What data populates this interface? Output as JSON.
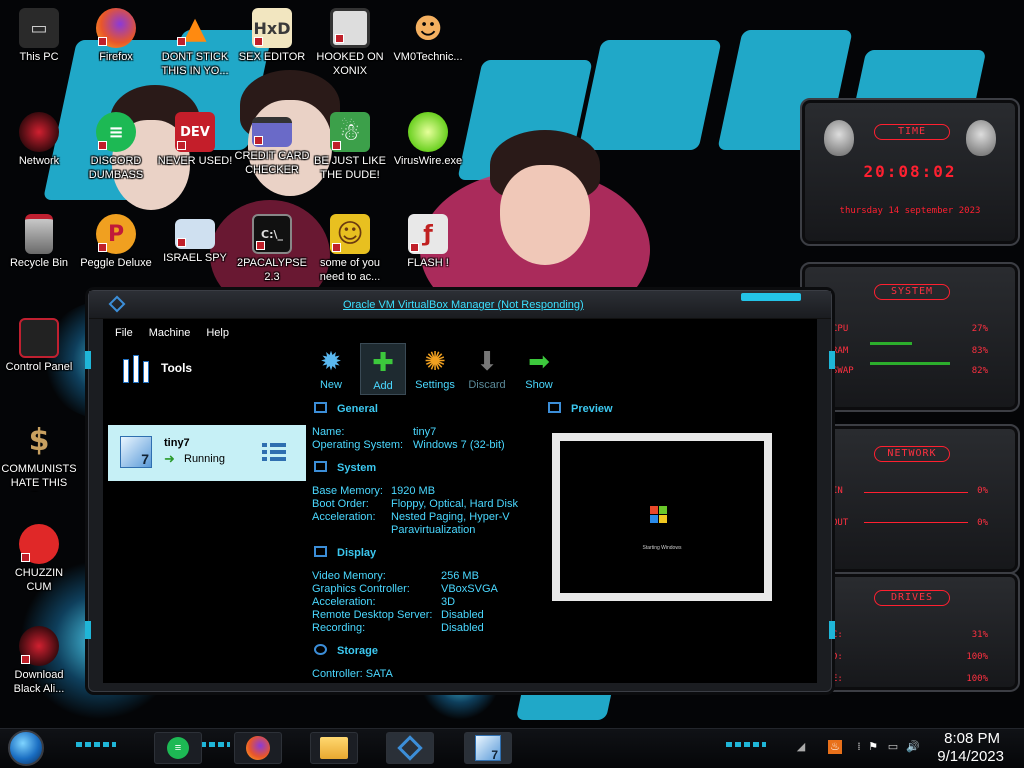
{
  "desktop": {
    "icons": [
      {
        "label": "This PC",
        "icon": "computer-icon"
      },
      {
        "label": "Firefox",
        "icon": "firefox-icon"
      },
      {
        "label": "DONT STICK THIS IN YO...",
        "icon": "vlc-icon"
      },
      {
        "label": "SEX EDITOR",
        "icon": "hxd-icon"
      },
      {
        "label": "HOOKED ON XONIX",
        "icon": "xonix-icon"
      },
      {
        "label": "VM0Technic...",
        "icon": "doctor-icon"
      },
      {
        "label": "Network",
        "icon": "network-icon"
      },
      {
        "label": "DISCORD DUMBASS",
        "icon": "green-chat-icon"
      },
      {
        "label": "NEVER USED!",
        "icon": "devcpp-icon"
      },
      {
        "label": "CREDIT CARD CHECKER",
        "icon": "credit-card-icon"
      },
      {
        "label": "BE JUST LIKE THE DUDE!",
        "icon": "santa-icon"
      },
      {
        "label": "VirusWire.exe",
        "icon": "lime-icon"
      },
      {
        "label": "Recycle Bin",
        "icon": "recycle-bin-icon"
      },
      {
        "label": "Peggle Deluxe",
        "icon": "peggle-icon"
      },
      {
        "label": "ISRAEL SPY",
        "icon": "spy-icon"
      },
      {
        "label": "2PACALYPSE 2.3",
        "icon": "cmd-icon"
      },
      {
        "label": "some of you need to ac...",
        "icon": "beaver-icon"
      },
      {
        "label": "FLASH !",
        "icon": "flash-icon"
      },
      {
        "label": "Control Panel",
        "icon": "control-panel-icon"
      },
      {
        "label": "COMMUNISTS HATE THIS G...",
        "icon": "money-bag-icon"
      },
      {
        "label": "CHUZZIN CUM",
        "icon": "chuzzle-icon"
      },
      {
        "label": "Download Black Ali...",
        "icon": "alienware-icon"
      }
    ]
  },
  "gadgets": {
    "time": {
      "title": "TIME",
      "time": "20:08:02",
      "date": "thursday 14 september 2023"
    },
    "system": {
      "title": "SYSTEM",
      "rows": [
        {
          "label": "CPU",
          "value": "27%"
        },
        {
          "label": "RAM",
          "value": "83%"
        },
        {
          "label": "SWAP",
          "value": "82%"
        }
      ]
    },
    "network": {
      "title": "NETWORK",
      "rows": [
        {
          "label": "IN",
          "value": "0%"
        },
        {
          "label": "OUT",
          "value": "0%"
        }
      ]
    },
    "drives": {
      "title": "DRIVES",
      "rows": [
        {
          "label": "C:",
          "value": "31%"
        },
        {
          "label": "D:",
          "value": "100%"
        },
        {
          "label": "E:",
          "value": "100%"
        }
      ]
    }
  },
  "vbox": {
    "title": "Oracle VM VirtualBox Manager (Not Responding)",
    "menu": [
      "File",
      "Machine",
      "Help"
    ],
    "tools_label": "Tools",
    "vm": {
      "name": "tiny7",
      "state": "Running"
    },
    "toolbar": [
      {
        "label": "New",
        "icon": "new-star-icon",
        "enabled": true
      },
      {
        "label": "Add",
        "icon": "add-plus-icon",
        "enabled": true
      },
      {
        "label": "Settings",
        "icon": "settings-gear-icon",
        "enabled": true
      },
      {
        "label": "Discard",
        "icon": "discard-arrow-icon",
        "enabled": false
      },
      {
        "label": "Show",
        "icon": "show-arrow-icon",
        "enabled": true
      }
    ],
    "sections": {
      "general": {
        "title": "General",
        "props": [
          {
            "k": "Name:",
            "v": "tiny7"
          },
          {
            "k": "Operating System:",
            "v": "Windows 7 (32-bit)"
          }
        ]
      },
      "system": {
        "title": "System",
        "props": [
          {
            "k": "Base Memory:",
            "v": "1920 MB"
          },
          {
            "k": "Boot Order:",
            "v": "Floppy, Optical, Hard Disk"
          },
          {
            "k": "Acceleration:",
            "v": "Nested Paging, Hyper-V"
          },
          {
            "k": "",
            "v": "Paravirtualization"
          }
        ]
      },
      "display": {
        "title": "Display",
        "props": [
          {
            "k": "Video Memory:",
            "v": "256 MB"
          },
          {
            "k": "Graphics Controller:",
            "v": "VBoxSVGA"
          },
          {
            "k": "Acceleration:",
            "v": "3D"
          },
          {
            "k": "Remote Desktop Server:",
            "v": "Disabled"
          },
          {
            "k": "Recording:",
            "v": "Disabled"
          }
        ]
      },
      "storage": {
        "title": "Storage",
        "props": [
          {
            "k": "Controller: SATA",
            "v": ""
          }
        ]
      },
      "preview": {
        "title": "Preview",
        "boot_text": "Starting Windows"
      }
    }
  },
  "taskbar": {
    "pinned": [
      "green-chat-icon",
      "firefox-icon",
      "explorer-folder-icon",
      "virtualbox-icon",
      "tiny7-vm-icon"
    ],
    "clock_time": "8:08 PM",
    "clock_date": "9/14/2023"
  },
  "colors": {
    "accent_cyan": "#1fb6d8",
    "text_cyan": "#4ad8ff",
    "gadget_red": "#ff3040",
    "vm_selected": "#c6f0f6"
  }
}
